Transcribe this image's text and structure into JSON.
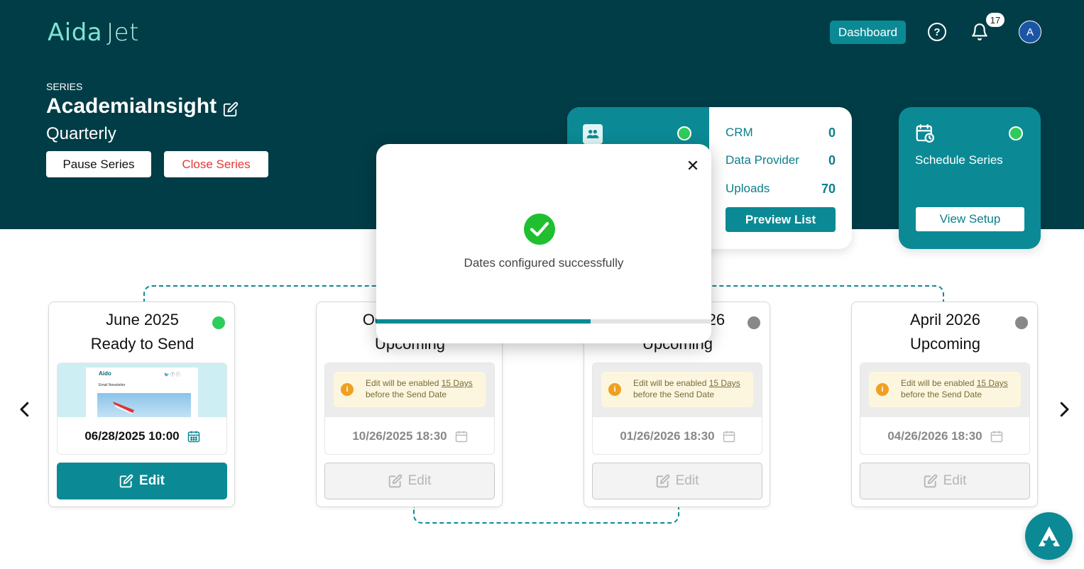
{
  "header": {
    "logo_text_a": "Aida",
    "logo_text_b": "Jet",
    "dashboard_label": "Dashboard",
    "notification_count": "17",
    "avatar_initial": "A"
  },
  "series": {
    "label": "SERIES",
    "title": "AcademiaInsight",
    "frequency": "Quarterly",
    "pause_label": "Pause Series",
    "close_label": "Close Series"
  },
  "audience": {
    "stats": [
      {
        "label": "CRM",
        "value": "0"
      },
      {
        "label": "Data Provider",
        "value": "0"
      },
      {
        "label": "Uploads",
        "value": "70"
      }
    ],
    "preview_label": "Preview List"
  },
  "schedule": {
    "label": "Schedule Series",
    "view_setup_label": "View Setup"
  },
  "issues": [
    {
      "month": "June 2025",
      "status": "Ready to Send",
      "date": "06/28/2025 10:00",
      "edit_label": "Edit"
    },
    {
      "month": "October 2025",
      "status": "Upcoming",
      "date": "10/26/2025 18:30",
      "edit_label": "Edit",
      "note_a": "Edit will be enabled ",
      "note_days": "15 Days",
      "note_b": "before the Send Date"
    },
    {
      "month": "January 2026",
      "status": "Upcoming",
      "date": "01/26/2026 18:30",
      "edit_label": "Edit",
      "note_a": "Edit will be enabled ",
      "note_days": "15 Days",
      "note_b": "before the Send Date"
    },
    {
      "month": "April 2026",
      "status": "Upcoming",
      "date": "04/26/2026 18:30",
      "edit_label": "Edit",
      "note_a": "Edit will be enabled ",
      "note_days": "15 Days",
      "note_b": "before the Send Date"
    }
  ],
  "thumbnail": {
    "brand": "Aido",
    "headline": "Email Newsletter",
    "social": "🐦 ⓕ ⓘ"
  },
  "modal": {
    "message": "Dates configured successfully",
    "close_glyph": "✕",
    "progress": 0.64
  },
  "colors": {
    "brand_dark": "#003d47",
    "accent": "#0b8a95",
    "status_ready": "#2ecc5a",
    "status_upcoming": "#888888"
  },
  "icons": {
    "help": "help-circle-icon",
    "bell": "bell-icon",
    "calendar": "calendar-icon",
    "edit": "edit-icon",
    "check": "check-circle-icon",
    "close": "close-icon"
  }
}
